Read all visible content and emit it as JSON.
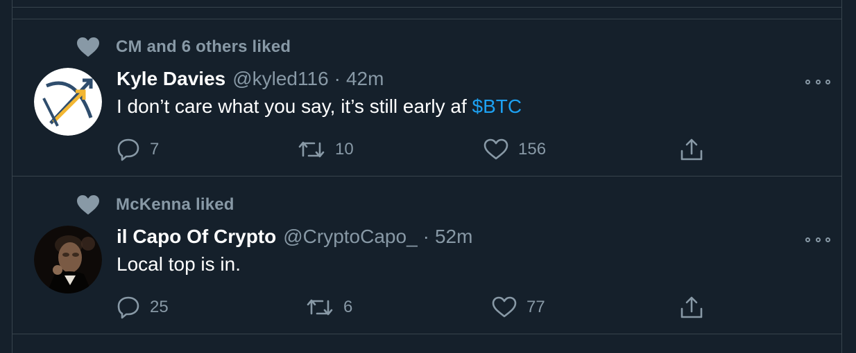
{
  "tweets": [
    {
      "social_context": "CM and 6 others liked",
      "name": "Kyle Davies",
      "handle": "@kyled116",
      "separator": "·",
      "time": "42m",
      "text": "I don’t care what you say, it’s still early af ",
      "cashtag": "$BTC",
      "replies": "7",
      "retweets": "10",
      "likes": "156",
      "avatar_icon": "arrows-logo-avatar"
    },
    {
      "social_context": "McKenna liked",
      "name": "il Capo Of Crypto",
      "handle": "@CryptoCapo_",
      "separator": "·",
      "time": "52m",
      "text": "Local top is in.",
      "cashtag": "",
      "replies": "25",
      "retweets": "6",
      "likes": "77",
      "avatar_icon": "portrait-avatar"
    }
  ],
  "colors": {
    "background": "#15202b",
    "border": "#38444d",
    "muted": "#8899a6",
    "link": "#1da1f2",
    "text": "#ffffff"
  }
}
